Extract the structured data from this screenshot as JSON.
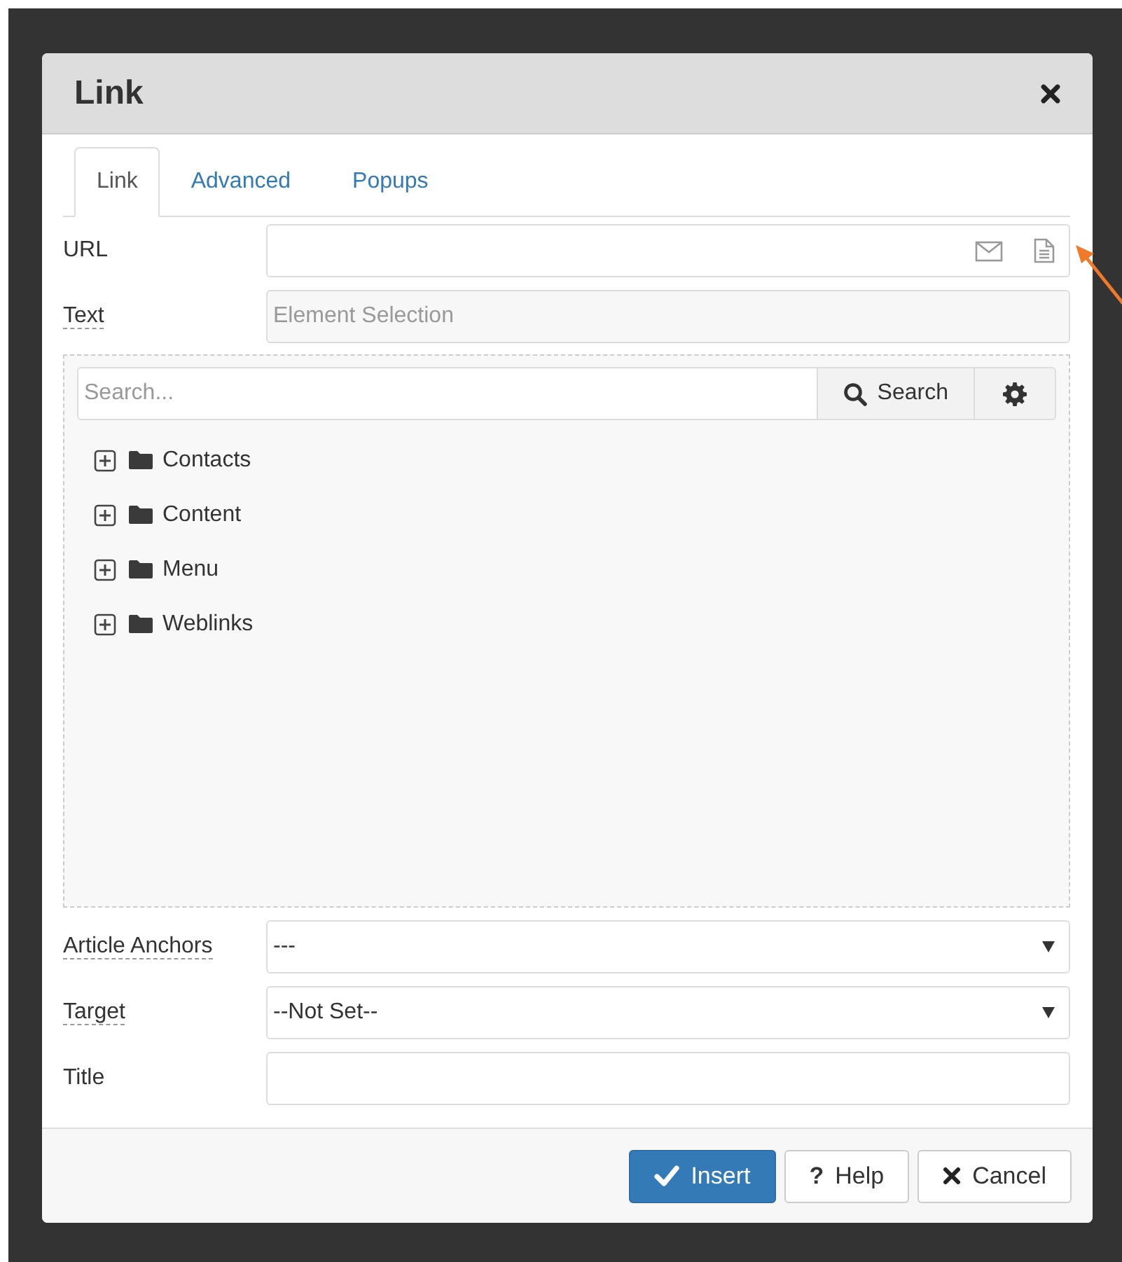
{
  "dialog": {
    "title": "Link"
  },
  "tabs": [
    {
      "label": "Link",
      "selected": true
    },
    {
      "label": "Advanced",
      "selected": false
    },
    {
      "label": "Popups",
      "selected": false
    }
  ],
  "url_field": {
    "label": "URL",
    "has_tooltip": false
  },
  "text_field": {
    "label": "Text",
    "has_tooltip": true,
    "placeholder": "Element Selection",
    "disabled": true
  },
  "browser": {
    "search": {
      "placeholder": "Search..."
    },
    "search_button": "Search",
    "tree": [
      {
        "label": "Contacts",
        "expanded": false
      },
      {
        "label": "Content",
        "expanded": false
      },
      {
        "label": "Menu",
        "expanded": false
      },
      {
        "label": "Weblinks",
        "expanded": false
      }
    ]
  },
  "fields": [
    {
      "kind": "select",
      "label": "Article Anchors",
      "has_tooltip": true,
      "value": "---"
    },
    {
      "kind": "select",
      "label": "Target",
      "has_tooltip": true,
      "value": "--Not Set--"
    },
    {
      "kind": "text",
      "label": "Title",
      "has_tooltip": false
    }
  ],
  "buttons": [
    {
      "kind": "primary",
      "label": "Insert"
    },
    {
      "kind": "help",
      "label": "Help",
      "icon": "?"
    },
    {
      "kind": "cancel",
      "label": "Cancel"
    }
  ]
}
